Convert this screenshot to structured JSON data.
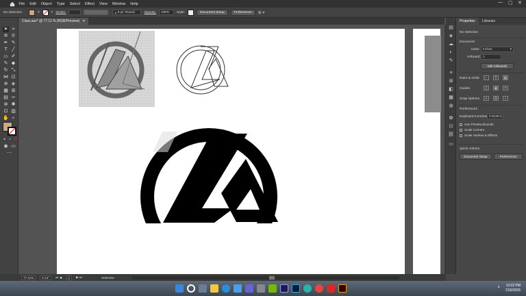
{
  "menubar": {
    "items": [
      "File",
      "Edit",
      "Object",
      "Type",
      "Select",
      "Effect",
      "View",
      "Window",
      "Help"
    ],
    "window_controls": [
      "—",
      "▢",
      "✕"
    ]
  },
  "control_bar": {
    "selection_label": "No Selection",
    "fill_color": "#c9a98a",
    "stroke_label": "Stroke:",
    "brush_label": "5 pt. Round",
    "opacity_label": "Opacity:",
    "opacity_value": "100%",
    "style_label": "Style:",
    "document_setup_label": "Document Setup",
    "preferences_label": "Preferences"
  },
  "document_tab": {
    "title": "Class.ass* @ 77.11 % (RGB/Preview)",
    "close": "✕"
  },
  "properties_panel": {
    "tabs": [
      "Properties",
      "Libraries"
    ],
    "selection": "No Selection",
    "document_header": "Document",
    "units_label": "Units:",
    "units_value": "Inches",
    "artboard_label": "Artboard:",
    "artboard_value": "1",
    "edit_artboards": "Edit Artboards",
    "rulers_label": "Ruler & Grids",
    "guides_label": "Guides",
    "snap_label": "Snap Options",
    "preferences_header": "Preferences",
    "keyboard_increment_label": "Keyboard Increment:",
    "keyboard_increment_value": "0.0139 in",
    "checkboxes": [
      "Use Preview Bounds",
      "Scale Corners",
      "Scale Strokes & Effects"
    ],
    "quick_actions_header": "Quick Actions",
    "quick_document_setup": "Document Setup",
    "quick_preferences": "Preferences"
  },
  "status_bar": {
    "zoom": "77.11%",
    "rotation": "0.13°",
    "artboard_nav": "1",
    "tool": "Selection"
  },
  "taskbar": {
    "time": "12:02 PM",
    "date": "7/26/2025",
    "tray": "∧",
    "app_icons": [
      "windows-icon",
      "search-icon",
      "file-explorer-icon",
      "folder-icon",
      "edge-icon",
      "photos-icon",
      "teams-icon",
      "settings-icon",
      "nvidia-icon",
      "after-effects-icon",
      "photoshop-icon",
      "edge-icon",
      "chrome-icon",
      "acrobat-icon",
      "illustrator-icon"
    ]
  },
  "colors": {
    "accent": "#cc3333",
    "illustrator": "#ff9a00",
    "photoshop": "#31a8ff"
  }
}
